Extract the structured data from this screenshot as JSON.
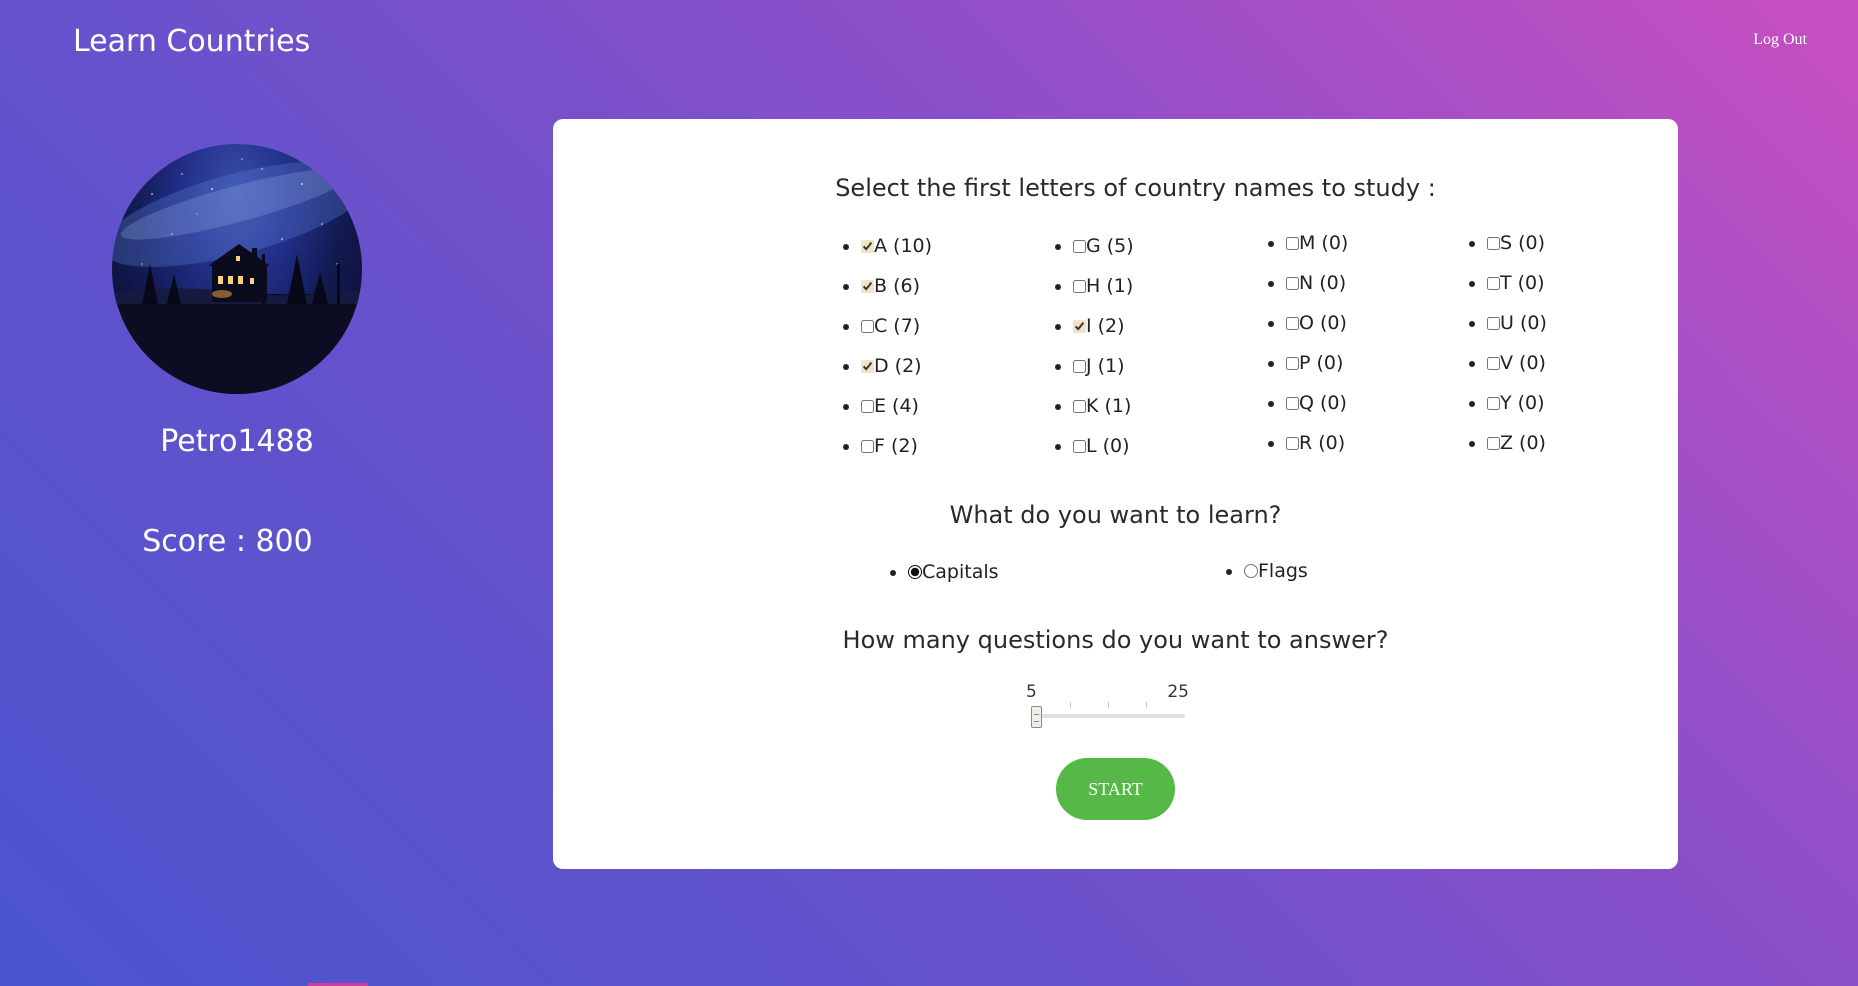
{
  "header": {
    "title": "Learn Countries",
    "logout_label": "Log Out"
  },
  "profile": {
    "username": "Petro1488",
    "score_text": "Score : 800"
  },
  "letters": {
    "heading": "Select the first letters of country names to study :",
    "columns": [
      [
        {
          "label": "A (10)",
          "checked": true
        },
        {
          "label": "B (6)",
          "checked": true
        },
        {
          "label": "C (7)",
          "checked": false
        },
        {
          "label": "D (2)",
          "checked": true
        },
        {
          "label": "E (4)",
          "checked": false
        },
        {
          "label": "F (2)",
          "checked": false
        }
      ],
      [
        {
          "label": "G (5)",
          "checked": false
        },
        {
          "label": "H (1)",
          "checked": false
        },
        {
          "label": "I (2)",
          "checked": true
        },
        {
          "label": "J (1)",
          "checked": false
        },
        {
          "label": "K (1)",
          "checked": false
        },
        {
          "label": "L (0)",
          "checked": false
        }
      ],
      [
        {
          "label": "M (0)",
          "checked": false
        },
        {
          "label": "N (0)",
          "checked": false
        },
        {
          "label": "O (0)",
          "checked": false
        },
        {
          "label": "P (0)",
          "checked": false
        },
        {
          "label": "Q (0)",
          "checked": false
        },
        {
          "label": "R (0)",
          "checked": false
        }
      ],
      [
        {
          "label": "S (0)",
          "checked": false
        },
        {
          "label": "T (0)",
          "checked": false
        },
        {
          "label": "U (0)",
          "checked": false
        },
        {
          "label": "V (0)",
          "checked": false
        },
        {
          "label": "Y (0)",
          "checked": false
        },
        {
          "label": "Z (0)",
          "checked": false
        }
      ]
    ]
  },
  "mode": {
    "heading": "What do you want to learn?",
    "options": [
      {
        "label": "Capitals",
        "selected": true
      },
      {
        "label": "Flags",
        "selected": false
      }
    ]
  },
  "questions": {
    "heading": "How many questions do you want to answer?",
    "min_label": "5",
    "max_label": "25",
    "min": 5,
    "max": 25,
    "value": 5
  },
  "start_label": "START",
  "colors": {
    "start_button": "#56b847",
    "card_bg": "#ffffff",
    "gradient_start": "#c94fc1",
    "gradient_end": "#4a55cf"
  },
  "icons": {
    "avatar": "night-house-landscape"
  }
}
